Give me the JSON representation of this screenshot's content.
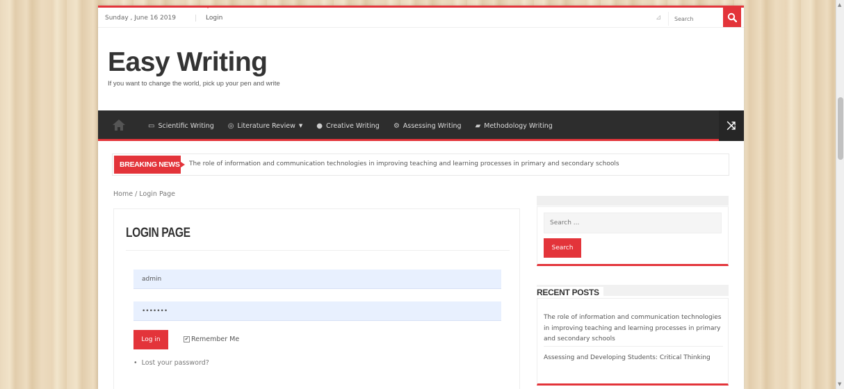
{
  "colors": {
    "accent": "#e3343a",
    "nav_bg": "#2d2d2d"
  },
  "topbar": {
    "date": "Sunday , June 16 2019",
    "login": "Login",
    "search_placeholder": "Search"
  },
  "header": {
    "site_title": "Easy Writing",
    "tagline": "If you want to change the world, pick up your pen and write"
  },
  "nav": {
    "items": [
      {
        "label": "Scientific Writing",
        "icon": "book-icon"
      },
      {
        "label": "Literature Review",
        "icon": "chat-icon",
        "dropdown": true
      },
      {
        "label": "Creative Writing",
        "icon": "eye-icon"
      },
      {
        "label": "Assessing Writing",
        "icon": "cogs-icon"
      },
      {
        "label": "Methodology Writing",
        "icon": "flag-icon"
      }
    ]
  },
  "breaking": {
    "label": "BREAKING NEWS",
    "text": "The role of information and communication technologies in improving teaching and learning processes in primary and secondary schools"
  },
  "breadcrumb": "Home  /  Login Page",
  "post": {
    "title": "LOGIN PAGE",
    "username_value": "admin",
    "password_value": "•••••••",
    "login_button": "Log in",
    "remember_label": "Remember Me",
    "lost_password": "Lost your password?"
  },
  "sidebar": {
    "search_placeholder": "Search ...",
    "search_button": "Search",
    "recent_title": "RECENT POSTS",
    "recent_posts": [
      "The role of information and communication technologies in improving teaching and learning processes in primary and secondary schools",
      "Assessing and Developing Students: Critical Thinking"
    ]
  }
}
